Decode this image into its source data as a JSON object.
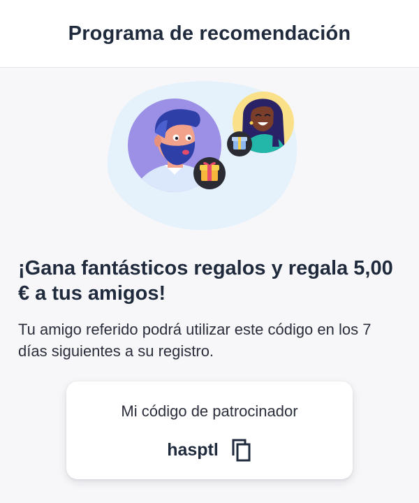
{
  "header": {
    "title": "Programa de recomendación"
  },
  "illustration": {
    "icons": [
      "man-avatar-icon",
      "woman-avatar-icon",
      "gift-icon",
      "gift-icon"
    ]
  },
  "main": {
    "headline": "¡Gana fantásticos regalos y regala 5,00 € a tus amigos!",
    "description": "Tu amigo referido podrá utilizar este código en los 7 días siguientes a su registro."
  },
  "code_card": {
    "label": "Mi código de patrocinador",
    "code": "hasptl",
    "copy_icon": "copy-icon"
  },
  "colors": {
    "background": "#f7f7f9",
    "text": "#1f2a3c",
    "blob": "#e6f2fb",
    "man_circle": "#9c8fe6",
    "woman_circle": "#fbe08a",
    "gift_badge": "#2b2b34"
  }
}
